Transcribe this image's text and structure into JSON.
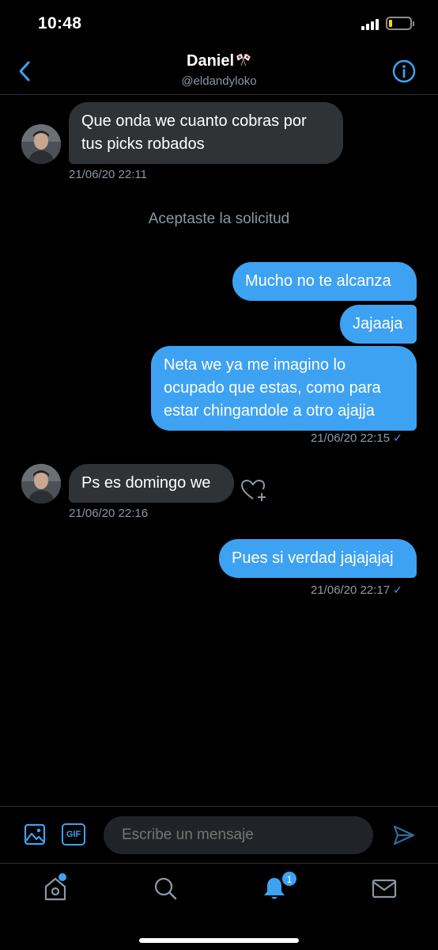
{
  "status_bar": {
    "time": "10:48"
  },
  "header": {
    "name": "Daniel",
    "flag": "🎌",
    "handle": "@eldandyloko"
  },
  "conversation": {
    "system_message": "Aceptaste la solicitud",
    "messages": [
      {
        "direction": "incoming",
        "text_lines": [
          "Que onda we cuanto cobras por",
          "tus picks robados"
        ],
        "timestamp": "21/06/20 22:11"
      },
      {
        "direction": "outgoing",
        "text_lines": [
          "Mucho no te alcanza"
        ]
      },
      {
        "direction": "outgoing",
        "text_lines": [
          "Jajaaja"
        ]
      },
      {
        "direction": "outgoing",
        "text_lines": [
          "Neta we ya me imagino lo",
          "ocupado que estas, como para",
          "estar chingandole a otro ajajja"
        ],
        "timestamp": "21/06/20 22:15",
        "read": true
      },
      {
        "direction": "incoming",
        "text_lines": [
          "Ps es domingo we"
        ],
        "timestamp": "21/06/20 22:16"
      },
      {
        "direction": "outgoing",
        "text_lines": [
          "Pues si verdad jajajajaj"
        ],
        "timestamp": "21/06/20 22:17",
        "read": true
      }
    ]
  },
  "composer": {
    "placeholder": "Escribe un mensaje",
    "gif_label": "GIF"
  },
  "tabbar": {
    "notifications_count": "1"
  },
  "icons": {
    "back": "chevron-left-icon",
    "info": "info-icon",
    "image": "image-icon",
    "send": "send-icon",
    "home": "home-icon",
    "search": "search-icon",
    "notifications": "bell-icon",
    "messages": "envelope-icon"
  },
  "colors": {
    "accent": "#3ea2f2",
    "background": "#000000",
    "incoming_bubble": "#2f3336",
    "muted_text": "#8b98a5"
  }
}
